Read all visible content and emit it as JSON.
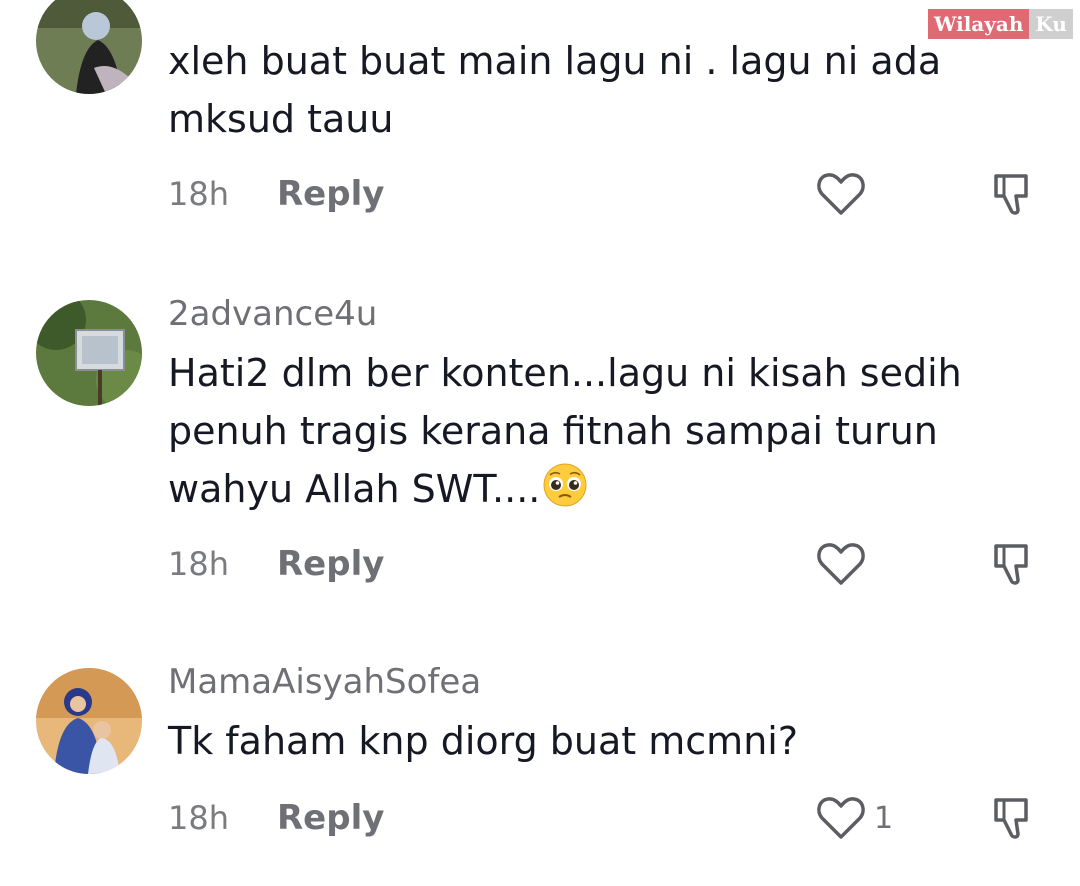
{
  "watermark": {
    "part1": "Wilayah",
    "part2": "Ku"
  },
  "comments": [
    {
      "username": "",
      "text": "xleh buat buat main lagu ni . lagu ni ada mksud tauu",
      "time": "18h",
      "reply_label": "Reply",
      "likes": ""
    },
    {
      "username": "2advance4u",
      "text": "Hati2 dlm ber konten...lagu ni kisah sedih penuh tragis kerana fitnah sampai turun wahyu Allah SWT....",
      "emoji": "pleading-face-emoji",
      "time": "18h",
      "reply_label": "Reply",
      "likes": ""
    },
    {
      "username": "MamaAisyahSofea",
      "text": "Tk faham knp diorg buat mcmni?",
      "time": "18h",
      "reply_label": "Reply",
      "likes": "1"
    }
  ],
  "icons": {
    "like": "heart-outline-icon",
    "dislike": "thumbs-down-outline-icon"
  },
  "colors": {
    "meta_gray": "#7a7b80",
    "text": "#161823",
    "watermark_red": "#e06a74"
  }
}
